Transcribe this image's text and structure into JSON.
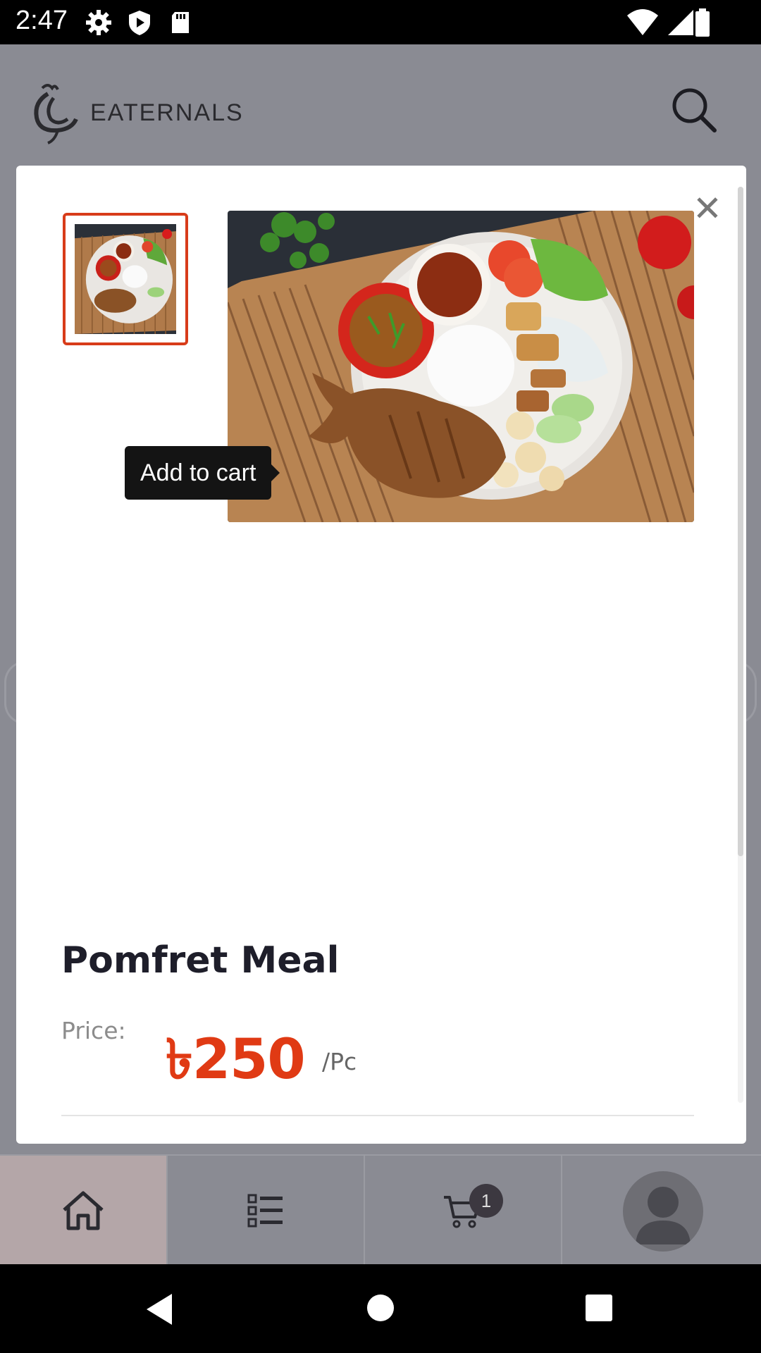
{
  "status_bar": {
    "time": "2:47",
    "left_icons": [
      "gear-icon",
      "play-protect-icon",
      "sd-card-icon"
    ],
    "right_icons": [
      "wifi-icon",
      "cell-signal-icon",
      "battery-icon"
    ]
  },
  "header": {
    "logo_text": "EATERNALS",
    "search_icon": "search-icon"
  },
  "modal": {
    "close_label": "✕",
    "product": {
      "name": "Pomfret Meal",
      "price_label": "Price:",
      "price_value": "৳250",
      "price_unit": "/Pc"
    },
    "tooltip": "Add to cart",
    "images": [
      "pomfret-meal-thumbnail",
      "pomfret-meal-main"
    ]
  },
  "bottom_nav": {
    "items": [
      {
        "name": "home",
        "icon": "home-icon"
      },
      {
        "name": "categories",
        "icon": "list-icon"
      },
      {
        "name": "cart",
        "icon": "cart-icon"
      },
      {
        "name": "account",
        "icon": "avatar-icon"
      }
    ],
    "cart_count": "1"
  },
  "system_nav": [
    "back-icon",
    "home-circle-icon",
    "recents-icon"
  ],
  "colors": {
    "accent": "#e03a14",
    "thumb_border": "#d83c1a",
    "overlay": "#8a8b93"
  }
}
